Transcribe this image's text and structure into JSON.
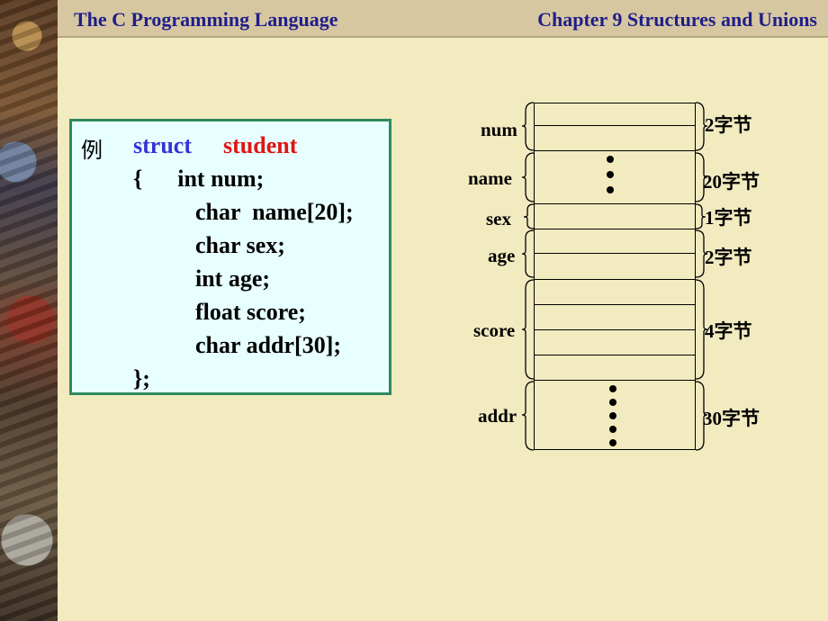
{
  "header": {
    "left_title": "The C Programming Language",
    "right_title": "Chapter 9 Structures  and Unions"
  },
  "code": {
    "example_label": "例",
    "keyword_struct": "struct",
    "struct_name": "student",
    "lines": [
      "{      int num;",
      "char  name[20];",
      "char sex;",
      "int age;",
      "float score;",
      "char addr[30];",
      "};"
    ]
  },
  "diagram": {
    "fields": [
      {
        "name": "num",
        "size": "2字节"
      },
      {
        "name": "name",
        "size": "20字节"
      },
      {
        "name": "sex",
        "size": "1字节"
      },
      {
        "name": "age",
        "size": "2字节"
      },
      {
        "name": "score",
        "size": "4字节"
      },
      {
        "name": "addr",
        "size": "30字节"
      }
    ]
  },
  "colors": {
    "header_text": "#1f1e8a",
    "struct_keyword": "#3533d6",
    "struct_name": "#e01414",
    "code_box_border": "#2e8a5e",
    "code_box_bg": "#e8ffff"
  }
}
